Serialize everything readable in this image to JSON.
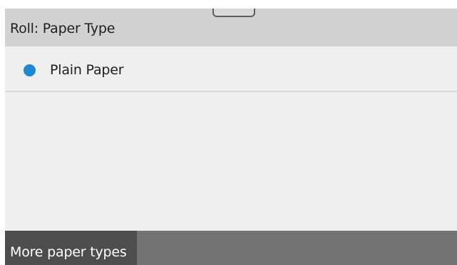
{
  "header": {
    "title": "Roll: Paper Type"
  },
  "list": {
    "items": [
      {
        "label": "Plain Paper",
        "selected": true
      }
    ]
  },
  "footer": {
    "more_label": "More paper types"
  },
  "colors": {
    "accent": "#1e88d2",
    "header_bg": "#d2d2d2",
    "content_bg": "#efefef",
    "footer_bg": "#737373",
    "footer_button_bg": "#4d4d4d"
  }
}
